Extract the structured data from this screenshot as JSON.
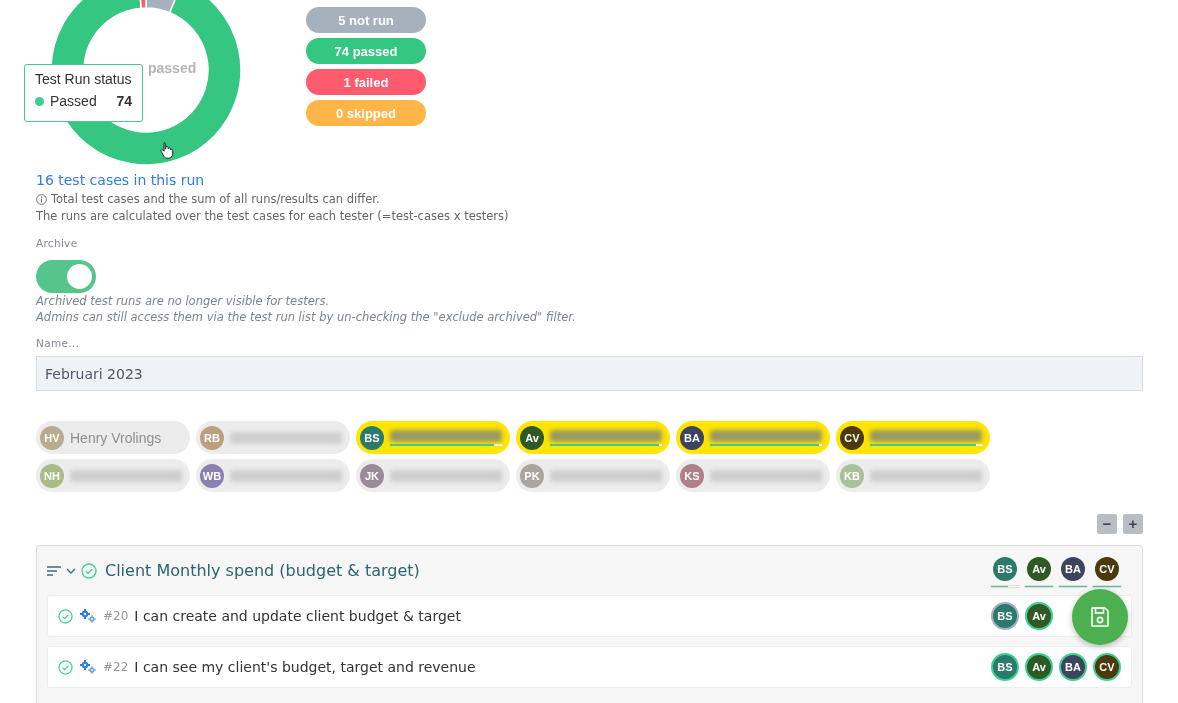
{
  "chart": {
    "center_label": "passed",
    "tooltip": {
      "title": "Test Run status",
      "label": "Passed",
      "value": "74",
      "color": "#3ecf8e"
    },
    "chart_data": {
      "type": "donut",
      "values": [
        6.25,
        92.5,
        1.25,
        0
      ]
    }
  },
  "legend": [
    {
      "label": "5 not run",
      "color": "#a7b1bd"
    },
    {
      "label": "74 passed",
      "color": "#35c682"
    },
    {
      "label": "1 failed",
      "color": "#ff5b6e"
    },
    {
      "label": "0 skipped",
      "color": "#ffb547"
    }
  ],
  "summary": {
    "link": "16 test cases in this run",
    "info": "Total test cases and the sum of all runs/results can differ.",
    "note": "The runs are calculated over the test cases for each tester (=test-cases x testers)"
  },
  "archive": {
    "label": "Archive",
    "on": true,
    "help": [
      "Archived test runs are no longer visible for testers.",
      "Admins can still access them via the test run list by un-checking the \"exclude archived\" filter."
    ]
  },
  "name_field": {
    "label": "Name...",
    "value": "Februari 2023"
  },
  "testers": [
    [
      {
        "initials": "HV",
        "name": "Henry Vrolings",
        "color": "#b9ab90",
        "selected": false
      },
      {
        "initials": "RB",
        "color": "#bba07f",
        "selected": false
      },
      {
        "initials": "BS",
        "color": "#2b7a6c",
        "selected": true,
        "level": 0.93
      },
      {
        "initials": "Av",
        "color": "#2f5a26",
        "selected": true,
        "level": 0.97
      },
      {
        "initials": "BA",
        "color": "#3d4460",
        "selected": true,
        "level": 0.97
      },
      {
        "initials": "CV",
        "color": "#4a3a0c",
        "selected": true,
        "level": 0.95
      }
    ],
    [
      {
        "initials": "NH",
        "color": "#a9bc88",
        "selected": false
      },
      {
        "initials": "WB",
        "color": "#8b80b2",
        "selected": false
      },
      {
        "initials": "JK",
        "color": "#9a8b9b",
        "selected": false
      },
      {
        "initials": "PK",
        "color": "#aaa69e",
        "selected": false
      },
      {
        "initials": "KS",
        "color": "#b07f88",
        "selected": false
      },
      {
        "initials": "KB",
        "color": "#a9c199",
        "selected": false
      }
    ]
  ],
  "zoom": {
    "minus": "−",
    "plus": "+"
  },
  "group": {
    "title": "Client Monthly spend (budget & target)",
    "expanded": true,
    "testers": [
      {
        "initials": "BS",
        "color": "#2b7a6c",
        "level": 0.6
      },
      {
        "initials": "Av",
        "color": "#2f5a26",
        "level": 1
      },
      {
        "initials": "BA",
        "color": "#3d4460",
        "level": 1
      },
      {
        "initials": "CV",
        "color": "#4a3a0c",
        "level": 1
      }
    ],
    "cases": [
      {
        "number": "#20",
        "title": "I can create and update client budget & target",
        "results": [
          {
            "initials": "BS",
            "color": "#2b7a6c",
            "passed": false
          },
          {
            "initials": "Av",
            "color": "#2f5a26",
            "passed": true
          }
        ]
      },
      {
        "number": "#22",
        "title": "I can see my client's budget, target and revenue",
        "results": [
          {
            "initials": "BS",
            "color": "#2b7a6c",
            "passed": true
          },
          {
            "initials": "Av",
            "color": "#2f5a26",
            "passed": true
          },
          {
            "initials": "BA",
            "color": "#3d4460",
            "passed": true
          },
          {
            "initials": "CV",
            "color": "#4a3a0c",
            "passed": true
          }
        ]
      }
    ]
  }
}
